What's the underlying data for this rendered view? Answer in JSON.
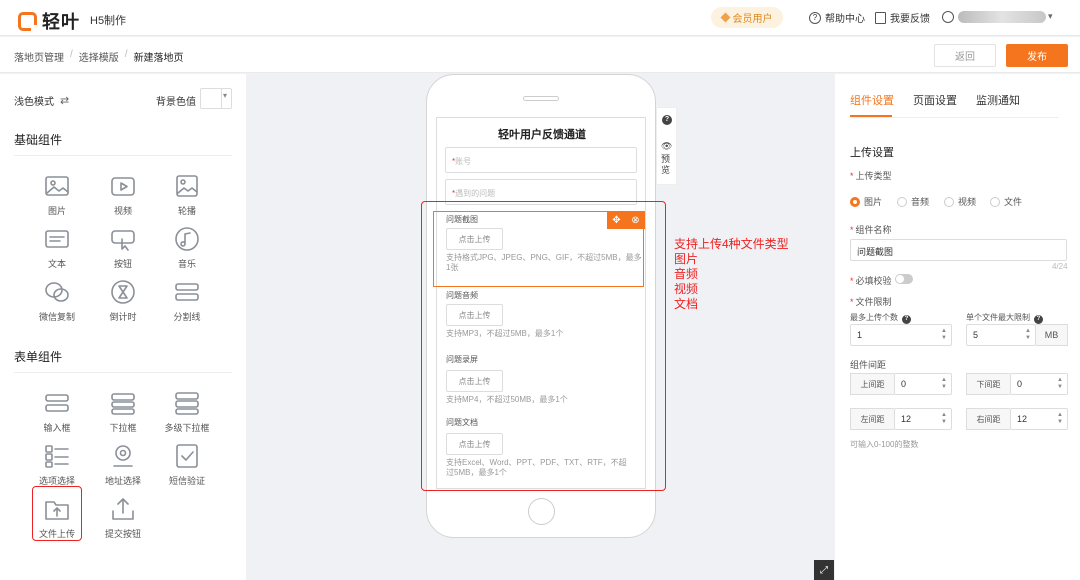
{
  "app": {
    "logo_text": "轻叶",
    "name": "H5制作"
  },
  "header": {
    "vip_label": "会员用户",
    "help_label": "帮助中心",
    "feedback_label": "我要反馈"
  },
  "breadcrumb": {
    "items": [
      "落地页管理",
      "选择模版",
      "新建落地页"
    ],
    "sep": "/"
  },
  "actions": {
    "back_label": "返回",
    "publish_label": "发布"
  },
  "left_panel": {
    "mode_label": "浅色模式",
    "bg_label": "背景色值",
    "basic_title": "基础组件",
    "basic_items": [
      {
        "label": "图片",
        "icon": "image-icon"
      },
      {
        "label": "视频",
        "icon": "video-icon"
      },
      {
        "label": "轮播",
        "icon": "carousel-icon"
      },
      {
        "label": "文本",
        "icon": "text-icon"
      },
      {
        "label": "按钮",
        "icon": "button-icon"
      },
      {
        "label": "音乐",
        "icon": "music-icon"
      },
      {
        "label": "微信复制",
        "icon": "wechat-icon"
      },
      {
        "label": "倒计时",
        "icon": "hourglass-icon"
      },
      {
        "label": "分割线",
        "icon": "divider-icon"
      }
    ],
    "form_title": "表单组件",
    "form_items": [
      {
        "label": "输入框",
        "icon": "input-icon"
      },
      {
        "label": "下拉框",
        "icon": "dropdown-icon"
      },
      {
        "label": "多级下拉框",
        "icon": "multi-dropdown-icon"
      },
      {
        "label": "选项选择",
        "icon": "options-icon"
      },
      {
        "label": "地址选择",
        "icon": "location-icon"
      },
      {
        "label": "短信验证",
        "icon": "sms-verify-icon"
      },
      {
        "label": "文件上传",
        "icon": "file-upload-icon"
      },
      {
        "label": "提交按钮",
        "icon": "submit-icon"
      }
    ]
  },
  "canvas": {
    "form_title": "轻叶用户反馈通道",
    "field_account": "账号",
    "field_problem": "遇到的问题",
    "upload_btn": "点击上传",
    "groups": [
      {
        "label": "问题截图",
        "hint": "支持格式JPG、JPEG、PNG、GIF，不超过5MB，最多1张"
      },
      {
        "label": "问题音频",
        "hint": "支持MP3，不超过5MB，最多1个"
      },
      {
        "label": "问题录屏",
        "hint": "支持MP4，不超过50MB，最多1个"
      },
      {
        "label": "问题文档",
        "hint": "支持Excel、Word、PPT、PDF、TXT、RTF，不超过5MB，最多1个"
      }
    ],
    "side_preview": "预览",
    "annotation": [
      "支持上传4种文件类型",
      "图片",
      "音频",
      "视频",
      "文档"
    ]
  },
  "right_panel": {
    "tabs": [
      "组件设置",
      "页面设置",
      "监测通知"
    ],
    "active_tab": "组件设置",
    "section_title": "上传设置",
    "upload_type_label": "上传类型",
    "upload_types": [
      "图片",
      "音频",
      "视频",
      "文件"
    ],
    "selected_type": "图片",
    "name_label": "组件名称",
    "name_value": "问题截图",
    "name_count": "4/24",
    "required_label": "必填校验",
    "limit_label": "文件限制",
    "max_count_label": "最多上传个数",
    "max_count_value": "1",
    "max_size_label": "单个文件最大限制",
    "max_size_value": "5",
    "max_size_unit": "MB",
    "spacing_label": "组件间距",
    "spacing": {
      "top_label": "上间距",
      "top_value": "0",
      "bottom_label": "下间距",
      "bottom_value": "0",
      "left_label": "左间距",
      "left_value": "12",
      "right_label": "右间距",
      "right_value": "12"
    },
    "spacing_note": "可输入0-100的整数"
  },
  "colors": {
    "accent": "#f4751d",
    "annotation": "#e22222"
  }
}
